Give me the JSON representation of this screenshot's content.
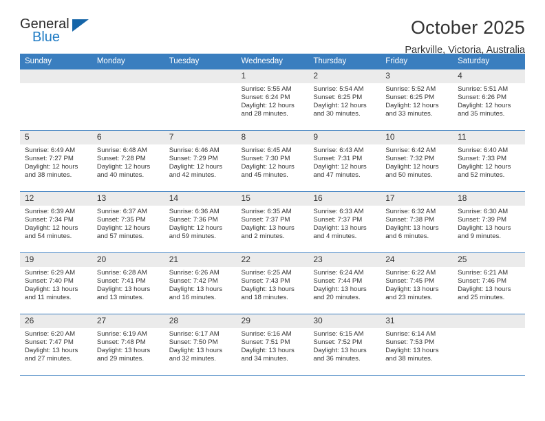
{
  "logo": {
    "line1": "General",
    "line2": "Blue",
    "triangle_icon": "logo-triangle-icon",
    "accent_color": "#1f7bc4"
  },
  "header": {
    "title": "October 2025",
    "subtitle": "Parkville, Victoria, Australia"
  },
  "theme": {
    "header_blue": "#3a7ebf",
    "daynum_band": "#ebebeb",
    "text": "#333333"
  },
  "labels": {
    "sunrise_prefix": "Sunrise:",
    "sunset_prefix": "Sunset:",
    "daylight_prefix": "Daylight:"
  },
  "weekdays": [
    "Sunday",
    "Monday",
    "Tuesday",
    "Wednesday",
    "Thursday",
    "Friday",
    "Saturday"
  ],
  "weeks": [
    [
      {
        "empty": true,
        "day": ""
      },
      {
        "empty": true,
        "day": ""
      },
      {
        "empty": true,
        "day": ""
      },
      {
        "day": "1",
        "sunrise": "Sunrise: 5:55 AM",
        "sunset": "Sunset: 6:24 PM",
        "daylight": "Daylight: 12 hours and 28 minutes."
      },
      {
        "day": "2",
        "sunrise": "Sunrise: 5:54 AM",
        "sunset": "Sunset: 6:25 PM",
        "daylight": "Daylight: 12 hours and 30 minutes."
      },
      {
        "day": "3",
        "sunrise": "Sunrise: 5:52 AM",
        "sunset": "Sunset: 6:25 PM",
        "daylight": "Daylight: 12 hours and 33 minutes."
      },
      {
        "day": "4",
        "sunrise": "Sunrise: 5:51 AM",
        "sunset": "Sunset: 6:26 PM",
        "daylight": "Daylight: 12 hours and 35 minutes."
      }
    ],
    [
      {
        "day": "5",
        "sunrise": "Sunrise: 6:49 AM",
        "sunset": "Sunset: 7:27 PM",
        "daylight": "Daylight: 12 hours and 38 minutes."
      },
      {
        "day": "6",
        "sunrise": "Sunrise: 6:48 AM",
        "sunset": "Sunset: 7:28 PM",
        "daylight": "Daylight: 12 hours and 40 minutes."
      },
      {
        "day": "7",
        "sunrise": "Sunrise: 6:46 AM",
        "sunset": "Sunset: 7:29 PM",
        "daylight": "Daylight: 12 hours and 42 minutes."
      },
      {
        "day": "8",
        "sunrise": "Sunrise: 6:45 AM",
        "sunset": "Sunset: 7:30 PM",
        "daylight": "Daylight: 12 hours and 45 minutes."
      },
      {
        "day": "9",
        "sunrise": "Sunrise: 6:43 AM",
        "sunset": "Sunset: 7:31 PM",
        "daylight": "Daylight: 12 hours and 47 minutes."
      },
      {
        "day": "10",
        "sunrise": "Sunrise: 6:42 AM",
        "sunset": "Sunset: 7:32 PM",
        "daylight": "Daylight: 12 hours and 50 minutes."
      },
      {
        "day": "11",
        "sunrise": "Sunrise: 6:40 AM",
        "sunset": "Sunset: 7:33 PM",
        "daylight": "Daylight: 12 hours and 52 minutes."
      }
    ],
    [
      {
        "day": "12",
        "sunrise": "Sunrise: 6:39 AM",
        "sunset": "Sunset: 7:34 PM",
        "daylight": "Daylight: 12 hours and 54 minutes."
      },
      {
        "day": "13",
        "sunrise": "Sunrise: 6:37 AM",
        "sunset": "Sunset: 7:35 PM",
        "daylight": "Daylight: 12 hours and 57 minutes."
      },
      {
        "day": "14",
        "sunrise": "Sunrise: 6:36 AM",
        "sunset": "Sunset: 7:36 PM",
        "daylight": "Daylight: 12 hours and 59 minutes."
      },
      {
        "day": "15",
        "sunrise": "Sunrise: 6:35 AM",
        "sunset": "Sunset: 7:37 PM",
        "daylight": "Daylight: 13 hours and 2 minutes."
      },
      {
        "day": "16",
        "sunrise": "Sunrise: 6:33 AM",
        "sunset": "Sunset: 7:37 PM",
        "daylight": "Daylight: 13 hours and 4 minutes."
      },
      {
        "day": "17",
        "sunrise": "Sunrise: 6:32 AM",
        "sunset": "Sunset: 7:38 PM",
        "daylight": "Daylight: 13 hours and 6 minutes."
      },
      {
        "day": "18",
        "sunrise": "Sunrise: 6:30 AM",
        "sunset": "Sunset: 7:39 PM",
        "daylight": "Daylight: 13 hours and 9 minutes."
      }
    ],
    [
      {
        "day": "19",
        "sunrise": "Sunrise: 6:29 AM",
        "sunset": "Sunset: 7:40 PM",
        "daylight": "Daylight: 13 hours and 11 minutes."
      },
      {
        "day": "20",
        "sunrise": "Sunrise: 6:28 AM",
        "sunset": "Sunset: 7:41 PM",
        "daylight": "Daylight: 13 hours and 13 minutes."
      },
      {
        "day": "21",
        "sunrise": "Sunrise: 6:26 AM",
        "sunset": "Sunset: 7:42 PM",
        "daylight": "Daylight: 13 hours and 16 minutes."
      },
      {
        "day": "22",
        "sunrise": "Sunrise: 6:25 AM",
        "sunset": "Sunset: 7:43 PM",
        "daylight": "Daylight: 13 hours and 18 minutes."
      },
      {
        "day": "23",
        "sunrise": "Sunrise: 6:24 AM",
        "sunset": "Sunset: 7:44 PM",
        "daylight": "Daylight: 13 hours and 20 minutes."
      },
      {
        "day": "24",
        "sunrise": "Sunrise: 6:22 AM",
        "sunset": "Sunset: 7:45 PM",
        "daylight": "Daylight: 13 hours and 23 minutes."
      },
      {
        "day": "25",
        "sunrise": "Sunrise: 6:21 AM",
        "sunset": "Sunset: 7:46 PM",
        "daylight": "Daylight: 13 hours and 25 minutes."
      }
    ],
    [
      {
        "day": "26",
        "sunrise": "Sunrise: 6:20 AM",
        "sunset": "Sunset: 7:47 PM",
        "daylight": "Daylight: 13 hours and 27 minutes."
      },
      {
        "day": "27",
        "sunrise": "Sunrise: 6:19 AM",
        "sunset": "Sunset: 7:48 PM",
        "daylight": "Daylight: 13 hours and 29 minutes."
      },
      {
        "day": "28",
        "sunrise": "Sunrise: 6:17 AM",
        "sunset": "Sunset: 7:50 PM",
        "daylight": "Daylight: 13 hours and 32 minutes."
      },
      {
        "day": "29",
        "sunrise": "Sunrise: 6:16 AM",
        "sunset": "Sunset: 7:51 PM",
        "daylight": "Daylight: 13 hours and 34 minutes."
      },
      {
        "day": "30",
        "sunrise": "Sunrise: 6:15 AM",
        "sunset": "Sunset: 7:52 PM",
        "daylight": "Daylight: 13 hours and 36 minutes."
      },
      {
        "day": "31",
        "sunrise": "Sunrise: 6:14 AM",
        "sunset": "Sunset: 7:53 PM",
        "daylight": "Daylight: 13 hours and 38 minutes."
      },
      {
        "empty": true,
        "day": ""
      }
    ]
  ]
}
